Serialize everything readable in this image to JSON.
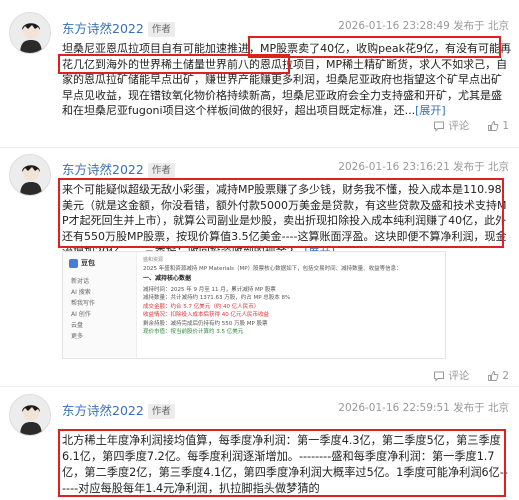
{
  "posts": [
    {
      "username": "东方诗然2022",
      "author_tag": "作者",
      "timestamp": "2026-01-16 23:28:49 发布于 北京",
      "content": "坦桑尼亚恩瓜拉项目自有可能加速推进，MP股票卖了40亿，收购peak花9亿，有没有可能再花几亿到海外的世界稀土储量世界前八的恩瓜拉项目，MP稀土精矿断货，求人不如求己，自家的恩瓜拉矿储能早点出矿，赚世界产能赚更多利润，坦桑尼亚政府也指望这个矿早点出矿早点见收益，现在镨钕氧化物价格持续新高，坦桑尼亚政府会全力支持盛和开矿，尤其是盛和在坦桑尼亚fugoni项目这个样板间做的很好，超出项目既定标准，还...",
      "expand": "[展开]",
      "actions": {
        "comment": "评论",
        "like": "1"
      }
    },
    {
      "username": "东方诗然2022",
      "author_tag": "作者",
      "timestamp": "2026-01-16 23:16:21 发布于 北京",
      "content": "来个可能疑似超级无敌小彩蛋，减持MP股票赚了多少钱，财务我不懂，投入成本是110.98美元（就是这金额，你没看错，额外付款5000万美金是贷款，有这些贷款及盛和技术支持MP才起死回生并上市），就算公司副业是炒股，卖出折现扣除投入成本纯利润赚了40亿，此外还有550万股MP股票，按现价算值3.5亿美金----这算账面浮盈。这块即便不算净利润，现金流增加20亿------三季报：收回投资收到的现金2...",
      "expand": "[展开]",
      "actions": {
        "comment": "评论",
        "like": "2"
      },
      "screenshot": {
        "logo": "豆包",
        "menu": [
          "新对话",
          "AI 搜索",
          "帮我写作",
          "AI 创作",
          "云盘",
          "更多"
        ],
        "title": "盛和资源",
        "subtitle": "2025 年盛和资源减持 MP Materials（MP）股票核心数据如下，包括交易时间、减持数量、收益等信息：",
        "section": "一、减持核心数据",
        "rows": [
          "减持时间：2025 年 9 月至 11 月，累计减持 MP 股票",
          "减持数量：共计减持约 1371.63 万股，约占 MP 总股本 8%",
          "成交金额：约合 5.7 亿美元（约 40 亿人民币）",
          "收益情况：扣除投入成本后获得 40 亿元人民币收益",
          "剩余持股：减持完成后仍持有约 550 万股 MP 股票",
          "现价市值：按当前股价计算约 3.5 亿美元"
        ]
      }
    },
    {
      "username": "东方诗然2022",
      "author_tag": "作者",
      "timestamp": "2026-01-16 22:59:51 发布于 北京",
      "content": "北方稀土年度净利润接均值算，每季度净利润：第一季度4.3亿，第二季度5亿，第三季度6.1亿，第四季度7.2亿。每季度利润逐渐增加。--------盛和每季度净利润：第一季度1.7亿，第二季度2亿，第三季度4.1亿，第四季度净利润大概率过5亿。1季度可能净利润6亿------对应每股每年1.4元净利润，扒拉脚指头做梦猜的"
    }
  ]
}
